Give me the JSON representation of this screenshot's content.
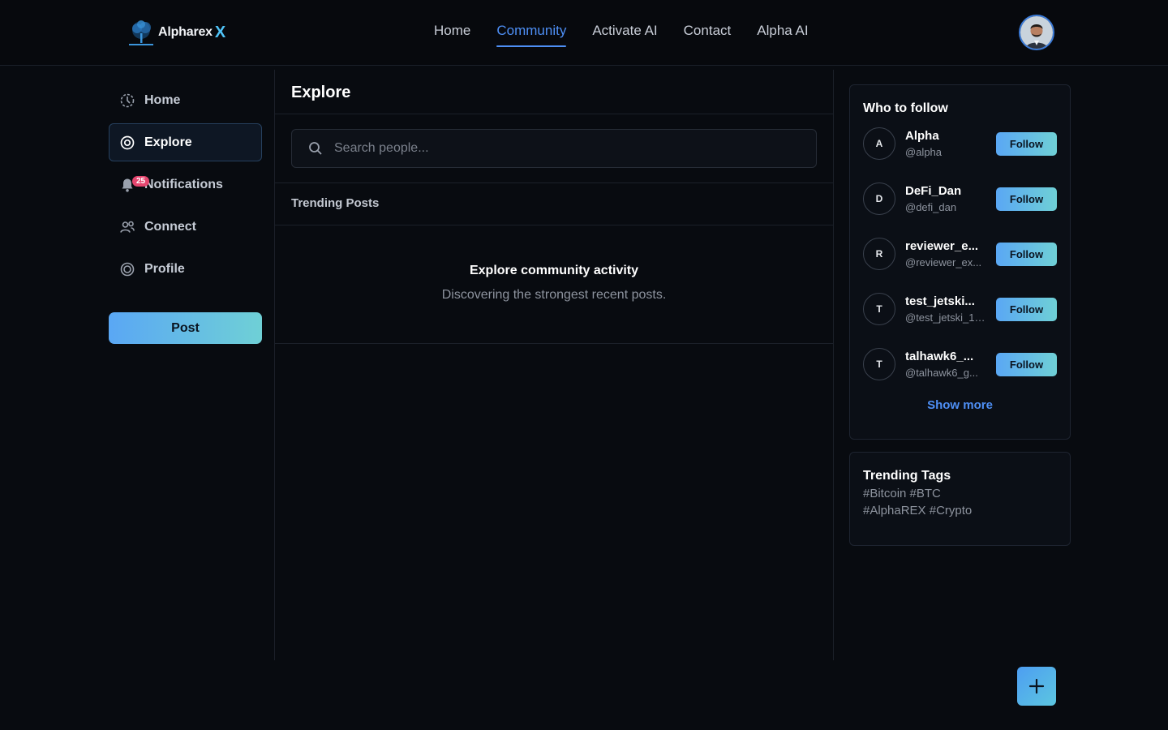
{
  "brand": {
    "name": "Alpharex",
    "mark": "X"
  },
  "nav": {
    "links": [
      {
        "label": "Home",
        "active": false
      },
      {
        "label": "Community",
        "active": true
      },
      {
        "label": "Activate AI",
        "active": false
      },
      {
        "label": "Contact",
        "active": false
      },
      {
        "label": "Alpha AI",
        "active": false
      }
    ]
  },
  "sidebar": {
    "items": [
      {
        "label": "Home",
        "icon": "home-icon"
      },
      {
        "label": "Explore",
        "icon": "explore-icon",
        "active": true
      },
      {
        "label": "Notifications",
        "icon": "bell-icon",
        "badge": "25"
      },
      {
        "label": "Connect",
        "icon": "users-icon"
      },
      {
        "label": "Profile",
        "icon": "profile-icon"
      }
    ],
    "post_label": "Post"
  },
  "main": {
    "title": "Explore",
    "search_placeholder": "Search people...",
    "section_title": "Trending Posts",
    "empty_title": "Explore community activity",
    "empty_subtitle": "Discovering the strongest recent posts."
  },
  "who_to_follow": {
    "title": "Who to follow",
    "follow_label": "Follow",
    "users": [
      {
        "initial": "A",
        "name": "Alpha",
        "handle": "@alpha"
      },
      {
        "initial": "D",
        "name": "DeFi_Dan",
        "handle": "@defi_dan"
      },
      {
        "initial": "R",
        "name": "reviewer_e...",
        "handle": "@reviewer_ex..."
      },
      {
        "initial": "T",
        "name": "test_jetski...",
        "handle": "@test_jetski_1_..."
      },
      {
        "initial": "T",
        "name": "talhawk6_...",
        "handle": "@talhawk6_g..."
      }
    ],
    "show_more": "Show more"
  },
  "trending_tags": {
    "title": "Trending Tags",
    "lines": [
      [
        "#Bitcoin",
        "#BTC"
      ],
      [
        "#AlphaREX",
        "#Crypto"
      ]
    ]
  },
  "colors": {
    "accent": "#4e8ff5",
    "badge": "#e5466f",
    "gradient_start": "#5aa7f4",
    "gradient_end": "#6fd0d6"
  }
}
